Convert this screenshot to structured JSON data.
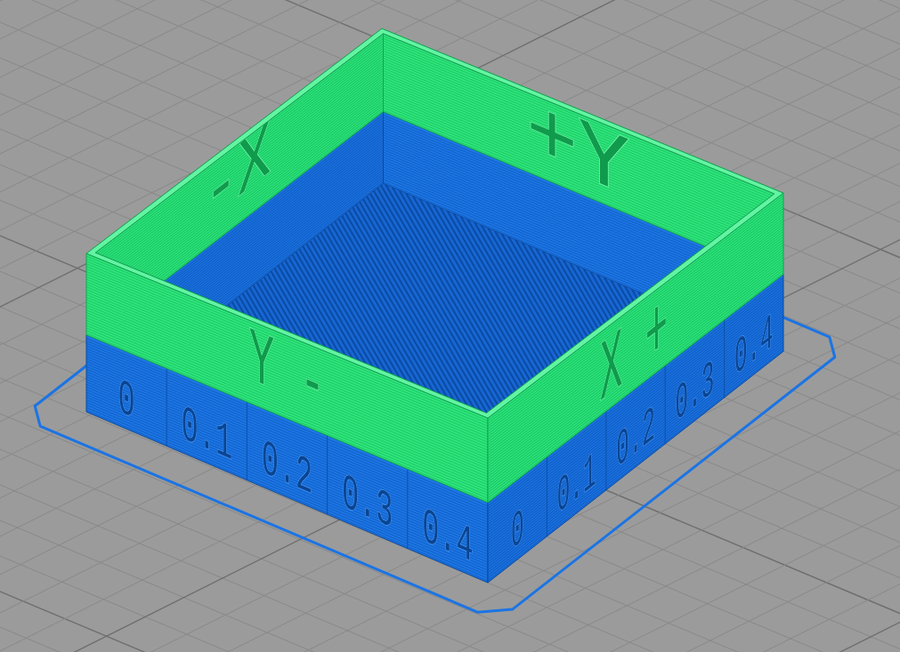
{
  "model": {
    "base": {
      "left_face_labels": [
        "0",
        "0.1",
        "0.2",
        "0.3",
        "0.4"
      ],
      "right_face_labels": [
        "0",
        "0.1",
        "0.2",
        "0.3",
        "0.4"
      ]
    },
    "upper_walls": {
      "left_face_label": "Y -",
      "right_face_label": "X +",
      "back_left_inner_label": "-X",
      "back_right_inner_label": "+Y"
    }
  }
}
